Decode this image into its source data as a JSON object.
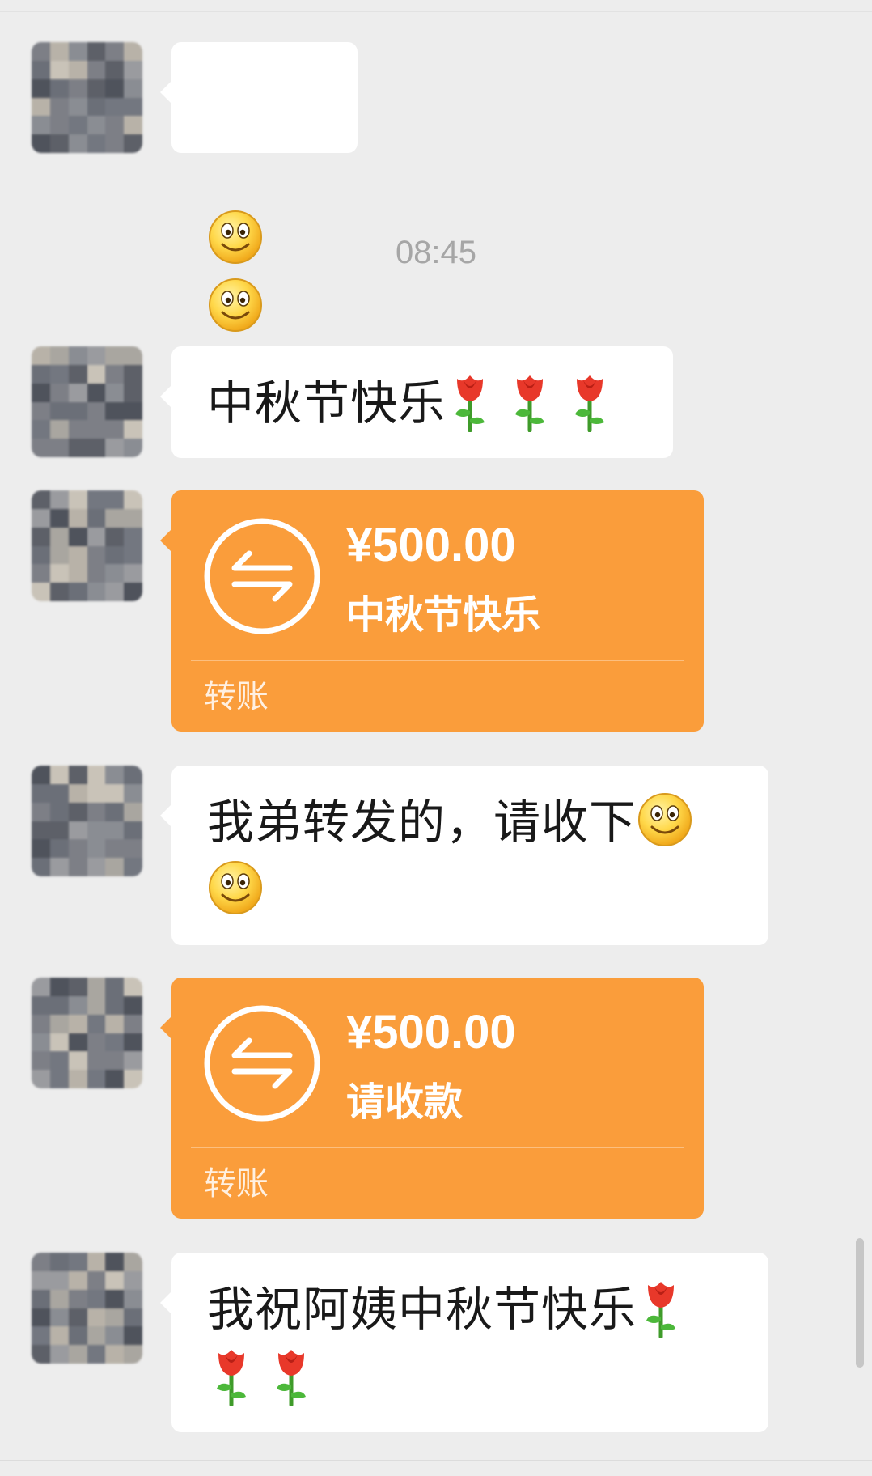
{
  "chat": {
    "timestamp": "08:45",
    "messages": [
      {
        "kind": "emoji",
        "emojis": [
          "smile-emoji",
          "smile-emoji"
        ]
      },
      {
        "kind": "text",
        "text": "中秋节快乐",
        "trailing": [
          "rose-emoji",
          "rose-emoji",
          "rose-emoji"
        ]
      },
      {
        "kind": "transfer",
        "amount": "¥500.00",
        "note": "中秋节快乐",
        "label": "转账"
      },
      {
        "kind": "text",
        "text_line1": "我弟转发的，请收下",
        "trailing_line1": [
          "smile-emoji"
        ],
        "trailing_line2": [
          "smile-emoji"
        ]
      },
      {
        "kind": "transfer",
        "amount": "¥500.00",
        "note": "请收款",
        "label": "转账"
      },
      {
        "kind": "text",
        "text_line1": "我祝阿姨中秋节快乐",
        "trailing_line1": [
          "rose-emoji"
        ],
        "trailing_line2": [
          "rose-emoji",
          "rose-emoji"
        ]
      }
    ]
  },
  "colors": {
    "background": "#ededed",
    "bubble": "#ffffff",
    "transfer": "#fa9d3b",
    "text": "#191919",
    "timestamp": "#a6a6a6"
  }
}
